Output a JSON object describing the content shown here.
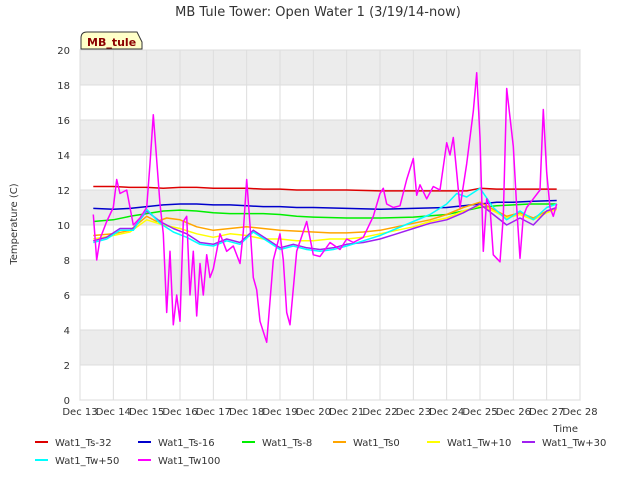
{
  "chart_data": {
    "type": "line",
    "title": "MB Tule Tower: Open Water 1 (3/19/14-now)",
    "xlabel": "Time",
    "ylabel": "Temperature (C)",
    "station_badge": "MB_tule",
    "ylim": [
      0,
      20
    ],
    "xlim": [
      13,
      28
    ],
    "x_ticks": [
      13,
      14,
      15,
      16,
      17,
      18,
      19,
      20,
      21,
      22,
      23,
      24,
      25,
      26,
      27,
      28
    ],
    "x_tick_labels": [
      "Dec 13",
      "Dec 14",
      "Dec 15",
      "Dec 16",
      "Dec 17",
      "Dec 18",
      "Dec 19",
      "Dec 20",
      "Dec 21",
      "Dec 22",
      "Dec 23",
      "Dec 24",
      "Dec 25",
      "Dec 26",
      "Dec 27",
      "Dec 28"
    ],
    "y_ticks": [
      0,
      2,
      4,
      6,
      8,
      10,
      12,
      14,
      16,
      18,
      20
    ],
    "y_tick_labels": [
      "0",
      "2",
      "4",
      "6",
      "8",
      "10",
      "12",
      "14",
      "16",
      "18",
      "20"
    ],
    "grid": true,
    "legend_position": "bottom",
    "series": [
      {
        "name": "Wat1_Ts-32",
        "color": "#dd0000",
        "x": [
          13.4,
          14,
          14.5,
          15,
          15.5,
          16,
          16.5,
          17,
          17.5,
          18,
          18.5,
          19,
          19.5,
          20,
          21,
          22,
          23,
          24,
          24.6,
          25,
          25.5,
          26,
          26.5,
          27.3
        ],
        "y": [
          12.2,
          12.2,
          12.15,
          12.15,
          12.1,
          12.15,
          12.15,
          12.1,
          12.1,
          12.1,
          12.05,
          12.05,
          12.0,
          12.0,
          12.0,
          11.95,
          11.95,
          11.95,
          11.95,
          12.1,
          12.05,
          12.05,
          12.05,
          12.05
        ]
      },
      {
        "name": "Wat1_Ts-16",
        "color": "#0000cc",
        "x": [
          13.4,
          14,
          14.5,
          15,
          15.5,
          16,
          16.5,
          17,
          17.5,
          18,
          18.5,
          19,
          19.5,
          20,
          21,
          22,
          23,
          24,
          24.5,
          25,
          25.5,
          26,
          26.5,
          27.3
        ],
        "y": [
          10.95,
          10.9,
          10.95,
          11.05,
          11.15,
          11.2,
          11.2,
          11.15,
          11.15,
          11.1,
          11.05,
          11.05,
          11.0,
          11.0,
          10.95,
          10.9,
          10.95,
          11.0,
          11.1,
          11.2,
          11.3,
          11.3,
          11.35,
          11.4
        ]
      },
      {
        "name": "Wat1_Ts-8",
        "color": "#00ee00",
        "x": [
          13.4,
          14,
          14.5,
          15,
          15.5,
          16,
          16.5,
          17,
          17.5,
          18,
          18.5,
          19,
          19.5,
          20,
          21,
          22,
          23,
          24,
          24.5,
          25,
          25.5,
          26,
          26.5,
          27.3
        ],
        "y": [
          10.2,
          10.3,
          10.5,
          10.65,
          10.8,
          10.85,
          10.8,
          10.7,
          10.65,
          10.65,
          10.65,
          10.6,
          10.5,
          10.45,
          10.4,
          10.4,
          10.45,
          10.6,
          10.8,
          11.0,
          11.1,
          11.15,
          11.2,
          11.2
        ]
      },
      {
        "name": "Wat1_Ts0",
        "color": "#ffa500",
        "x": [
          13.4,
          14,
          14.5,
          15,
          15.3,
          15.6,
          16,
          16.5,
          17,
          17.5,
          18,
          18.5,
          19,
          19.5,
          20,
          20.5,
          21,
          21.5,
          22,
          22.5,
          23,
          23.5,
          24,
          24.5,
          25,
          25.4,
          25.8,
          26.2,
          26.6,
          27,
          27.3
        ],
        "y": [
          9.4,
          9.5,
          9.7,
          10.5,
          10.2,
          10.4,
          10.3,
          9.9,
          9.7,
          9.8,
          9.9,
          9.8,
          9.7,
          9.65,
          9.6,
          9.55,
          9.55,
          9.6,
          9.7,
          9.9,
          10.1,
          10.3,
          10.6,
          11.0,
          11.3,
          10.9,
          10.5,
          10.7,
          10.4,
          10.8,
          10.9
        ]
      },
      {
        "name": "Wat1_Tw+10",
        "color": "#ffff00",
        "x": [
          13.4,
          14,
          14.5,
          15,
          15.5,
          16,
          16.5,
          17,
          17.5,
          18,
          18.5,
          19,
          19.5,
          20,
          20.5,
          21,
          21.5,
          22,
          22.5,
          23,
          23.5,
          24,
          24.5,
          25,
          25.4,
          25.8,
          26.2,
          26.6,
          27,
          27.3
        ],
        "y": [
          9.2,
          9.4,
          9.6,
          10.3,
          10.0,
          9.8,
          9.5,
          9.3,
          9.5,
          9.4,
          9.2,
          9.2,
          9.1,
          9.1,
          9.2,
          9.2,
          9.3,
          9.5,
          9.7,
          9.9,
          10.2,
          10.4,
          10.8,
          11.1,
          10.8,
          10.4,
          10.6,
          10.3,
          10.7,
          10.9
        ]
      },
      {
        "name": "Wat1_Tw+30",
        "color": "#a020f0",
        "x": [
          13.4,
          13.8,
          14.2,
          14.6,
          15,
          15.4,
          15.8,
          16.2,
          16.6,
          17,
          17.4,
          17.8,
          18.2,
          18.6,
          19,
          19.4,
          19.8,
          20.2,
          20.6,
          21,
          21.5,
          22,
          22.5,
          23,
          23.5,
          24,
          24.5,
          25,
          25.4,
          25.8,
          26.2,
          26.6,
          27,
          27.3
        ],
        "y": [
          9.1,
          9.3,
          9.8,
          9.8,
          10.8,
          10.2,
          9.8,
          9.5,
          9.0,
          8.9,
          9.2,
          9.0,
          9.7,
          9.2,
          8.7,
          8.9,
          8.7,
          8.6,
          8.7,
          8.9,
          9.0,
          9.2,
          9.5,
          9.8,
          10.1,
          10.3,
          10.7,
          11.2,
          10.6,
          10.0,
          10.4,
          10.0,
          10.8,
          11.0
        ]
      },
      {
        "name": "Wat1_Tw+50",
        "color": "#00ffff",
        "x": [
          13.4,
          13.8,
          14.2,
          14.6,
          15,
          15.4,
          15.8,
          16.2,
          16.6,
          17,
          17.4,
          17.8,
          18.2,
          18.6,
          19,
          19.4,
          19.8,
          20.2,
          20.6,
          21,
          21.5,
          22,
          22.5,
          23,
          23.5,
          24,
          24.3,
          24.6,
          25,
          25.4,
          25.8,
          26.2,
          26.6,
          27,
          27.3
        ],
        "y": [
          9.0,
          9.2,
          9.7,
          9.7,
          10.9,
          10.1,
          9.6,
          9.3,
          8.9,
          8.8,
          9.1,
          8.9,
          9.6,
          9.1,
          8.6,
          8.8,
          8.6,
          8.5,
          8.6,
          8.8,
          9.1,
          9.4,
          9.8,
          10.2,
          10.6,
          11.2,
          11.8,
          11.6,
          12.1,
          11.0,
          10.3,
          10.8,
          10.3,
          11.0,
          11.2
        ]
      },
      {
        "name": "Wat1_Tw100",
        "color": "#ff00ff",
        "x": [
          13.4,
          13.5,
          13.6,
          13.8,
          14.0,
          14.1,
          14.2,
          14.4,
          14.6,
          14.8,
          15.0,
          15.1,
          15.2,
          15.4,
          15.5,
          15.6,
          15.7,
          15.8,
          15.9,
          16.0,
          16.1,
          16.2,
          16.3,
          16.4,
          16.5,
          16.6,
          16.7,
          16.8,
          16.9,
          17.0,
          17.2,
          17.4,
          17.6,
          17.8,
          17.9,
          18.0,
          18.1,
          18.2,
          18.3,
          18.4,
          18.6,
          18.8,
          19.0,
          19.1,
          19.2,
          19.3,
          19.5,
          19.8,
          20.0,
          20.2,
          20.5,
          20.8,
          21.0,
          21.2,
          21.5,
          21.8,
          22.0,
          22.1,
          22.2,
          22.4,
          22.6,
          22.8,
          23.0,
          23.1,
          23.2,
          23.4,
          23.6,
          23.8,
          24.0,
          24.1,
          24.2,
          24.3,
          24.4,
          24.6,
          24.8,
          24.9,
          25.0,
          25.1,
          25.2,
          25.3,
          25.4,
          25.6,
          25.7,
          25.8,
          26.0,
          26.1,
          26.2,
          26.3,
          26.4,
          26.6,
          26.8,
          26.9,
          27.0,
          27.1,
          27.2,
          27.3
        ],
        "y": [
          10.6,
          8.0,
          9.2,
          10.2,
          11.0,
          12.6,
          11.8,
          12.0,
          10.0,
          10.4,
          11.0,
          13.5,
          16.3,
          11.2,
          9.5,
          5.0,
          8.5,
          4.3,
          6.0,
          4.5,
          10.2,
          10.5,
          6.0,
          8.5,
          4.8,
          7.8,
          6.0,
          8.3,
          7.0,
          7.5,
          9.5,
          8.5,
          8.8,
          7.8,
          9.6,
          12.6,
          10.0,
          7.0,
          6.3,
          4.5,
          3.3,
          8.0,
          9.5,
          8.0,
          5.0,
          4.3,
          8.5,
          10.2,
          8.3,
          8.2,
          9.0,
          8.6,
          9.2,
          9.0,
          9.3,
          10.5,
          11.8,
          12.1,
          11.2,
          11.0,
          11.1,
          12.6,
          13.8,
          11.7,
          12.3,
          11.5,
          12.2,
          12.0,
          14.7,
          14.0,
          15.0,
          13.0,
          11.0,
          13.5,
          16.5,
          18.7,
          15.0,
          8.5,
          11.5,
          11.0,
          8.3,
          7.9,
          10.5,
          17.8,
          14.5,
          11.0,
          8.1,
          10.5,
          11.0,
          11.5,
          12.0,
          16.6,
          13.0,
          11.0,
          10.5,
          11.2
        ]
      }
    ]
  }
}
